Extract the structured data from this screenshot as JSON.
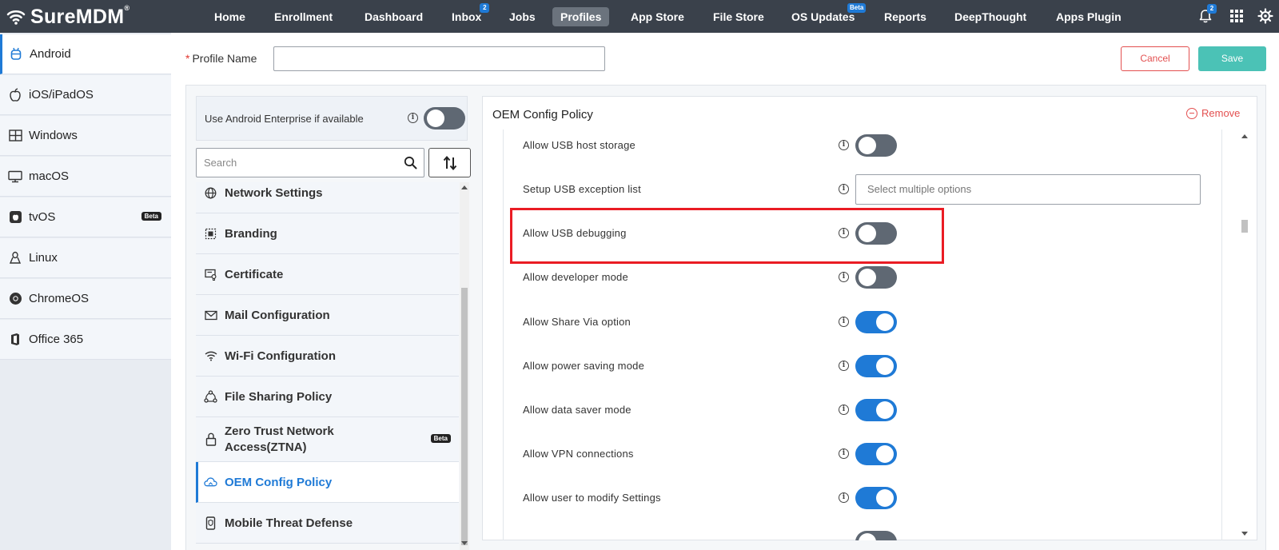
{
  "brand": {
    "name": "SureMDM",
    "reg": "®"
  },
  "nav": {
    "items": [
      {
        "label": "Home",
        "badge": ""
      },
      {
        "label": "Enrollment",
        "badge": ""
      },
      {
        "label": "Dashboard",
        "badge": ""
      },
      {
        "label": "Inbox",
        "badge": "2"
      },
      {
        "label": "Jobs",
        "badge": ""
      },
      {
        "label": "Profiles",
        "badge": "",
        "active": true
      },
      {
        "label": "App Store",
        "badge": ""
      },
      {
        "label": "File Store",
        "badge": ""
      },
      {
        "label": "OS Updates",
        "badge": "Beta"
      },
      {
        "label": "Reports",
        "badge": ""
      },
      {
        "label": "DeepThought",
        "badge": ""
      },
      {
        "label": "Apps Plugin",
        "badge": ""
      }
    ],
    "notifications_count": "2",
    "icons": [
      "bell-icon",
      "apps-grid-icon",
      "settings-gear-icon"
    ]
  },
  "os_sidebar": {
    "items": [
      {
        "label": "Android",
        "icon": "android-icon",
        "active": true
      },
      {
        "label": "iOS/iPadOS",
        "icon": "apple-icon"
      },
      {
        "label": "Windows",
        "icon": "windows-icon"
      },
      {
        "label": "macOS",
        "icon": "monitor-icon"
      },
      {
        "label": "tvOS",
        "icon": "apple-tv-icon",
        "badge": "Beta"
      },
      {
        "label": "Linux",
        "icon": "linux-icon"
      },
      {
        "label": "ChromeOS",
        "icon": "chrome-icon"
      },
      {
        "label": "Office 365",
        "icon": "office-icon"
      }
    ]
  },
  "profile": {
    "name_label": "Profile Name",
    "required_mark": "*",
    "name_value": "",
    "cancel_label": "Cancel",
    "save_label": "Save"
  },
  "categories": {
    "android_enterprise_label": "Use Android Enterprise if available",
    "android_enterprise_enabled": false,
    "search_placeholder": "Search",
    "items": [
      {
        "label": "Network Settings",
        "icon": "globe-icon"
      },
      {
        "label": "Branding",
        "icon": "branding-icon"
      },
      {
        "label": "Certificate",
        "icon": "certificate-icon"
      },
      {
        "label": "Mail Configuration",
        "icon": "mail-icon"
      },
      {
        "label": "Wi-Fi Configuration",
        "icon": "wifi-icon"
      },
      {
        "label": "File Sharing Policy",
        "icon": "share-icon"
      },
      {
        "label": "Zero Trust Network Access(ZTNA)",
        "line1": "Zero Trust Network",
        "line2": "Access(ZTNA)",
        "icon": "lock-icon",
        "badge": "Beta"
      },
      {
        "label": "OEM Config Policy",
        "icon": "cloud-icon",
        "active": true
      },
      {
        "label": "Mobile Threat Defense",
        "icon": "mobile-shield-icon"
      }
    ]
  },
  "oem": {
    "title": "OEM Config Policy",
    "remove_label": "Remove",
    "settings": [
      {
        "label": "Allow USB host storage",
        "type": "toggle",
        "enabled": false
      },
      {
        "label": "Setup USB exception list",
        "type": "multiselect",
        "placeholder": "Select multiple options"
      },
      {
        "label": "Allow USB debugging",
        "type": "toggle",
        "enabled": false,
        "highlighted": true
      },
      {
        "label": "Allow developer mode",
        "type": "toggle",
        "enabled": false
      },
      {
        "label": "Allow Share Via option",
        "type": "toggle",
        "enabled": true
      },
      {
        "label": "Allow power saving mode",
        "type": "toggle",
        "enabled": true
      },
      {
        "label": "Allow data saver mode",
        "type": "toggle",
        "enabled": true
      },
      {
        "label": "Allow VPN connections",
        "type": "toggle",
        "enabled": true
      },
      {
        "label": "Allow user to modify Settings",
        "type": "toggle",
        "enabled": true
      }
    ]
  },
  "colors": {
    "topbar": "#3a414b",
    "accent": "#1f7ad6",
    "save": "#4bc2b6",
    "danger": "#e35050",
    "highlight": "#ea1c24"
  }
}
